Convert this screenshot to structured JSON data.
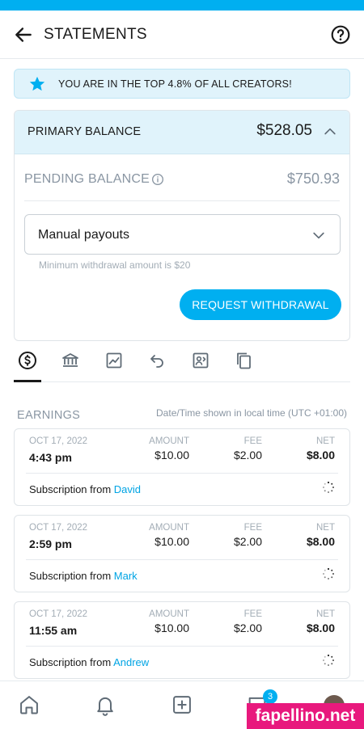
{
  "header": {
    "title": "STATEMENTS"
  },
  "banner": {
    "text": "YOU ARE IN THE TOP 4.8% OF ALL CREATORS!"
  },
  "balance": {
    "primary_label": "PRIMARY BALANCE",
    "primary_amount": "$528.05",
    "pending_label": "PENDING BALANCE",
    "pending_amount": "$750.93",
    "payout_mode": "Manual payouts",
    "min_note": "Minimum withdrawal amount is $20",
    "withdraw_label": "REQUEST WITHDRAWAL"
  },
  "tabs": [
    {
      "icon": "dollar-circle-icon"
    },
    {
      "icon": "bank-icon"
    },
    {
      "icon": "chart-icon"
    },
    {
      "icon": "refund-icon"
    },
    {
      "icon": "statement-icon"
    },
    {
      "icon": "copy-icon"
    }
  ],
  "earnings": {
    "title": "EARNINGS",
    "note": "Date/Time shown in local time (UTC +01:00)",
    "labels": {
      "amount": "AMOUNT",
      "fee": "FEE",
      "net": "NET"
    },
    "rows": [
      {
        "date": "OCT 17, 2022",
        "time": "4:43 pm",
        "amount": "$10.00",
        "fee": "$2.00",
        "net": "$8.00",
        "desc_prefix": "Subscription from",
        "who": "David"
      },
      {
        "date": "OCT 17, 2022",
        "time": "2:59 pm",
        "amount": "$10.00",
        "fee": "$2.00",
        "net": "$8.00",
        "desc_prefix": "Subscription from",
        "who": "Mark"
      },
      {
        "date": "OCT 17, 2022",
        "time": "11:55 am",
        "amount": "$10.00",
        "fee": "$2.00",
        "net": "$8.00",
        "desc_prefix": "Subscription from",
        "who": "Andrew"
      }
    ]
  },
  "nav": {
    "messages_badge": "3"
  },
  "watermark": "fapellino.net",
  "colors": {
    "accent": "#00aff0",
    "link": "#00a4e4",
    "banner_bg": "#e0f3fb",
    "muted": "#8a96a3"
  }
}
